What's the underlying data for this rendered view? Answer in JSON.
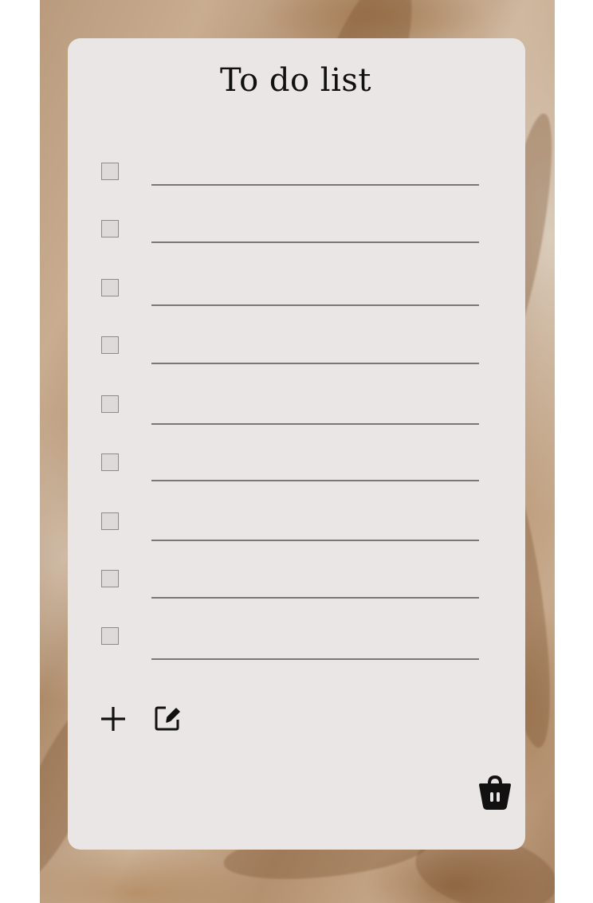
{
  "app": {
    "title": "To do list"
  },
  "tasks": [
    {
      "text": "",
      "checked": false
    },
    {
      "text": "",
      "checked": false
    },
    {
      "text": "",
      "checked": false
    },
    {
      "text": "",
      "checked": false
    },
    {
      "text": "",
      "checked": false
    },
    {
      "text": "",
      "checked": false
    },
    {
      "text": "",
      "checked": false
    },
    {
      "text": "",
      "checked": false
    },
    {
      "text": "",
      "checked": false
    }
  ],
  "toolbar": {
    "add_icon": "plus-icon",
    "edit_icon": "edit-icon",
    "delete_icon": "trash-icon"
  },
  "colors": {
    "card_background": "#ebe6e6",
    "line": "#7a7777",
    "checkbox_fill": "#dedad9",
    "checkbox_border": "#8d8a89",
    "icon": "#111111"
  }
}
